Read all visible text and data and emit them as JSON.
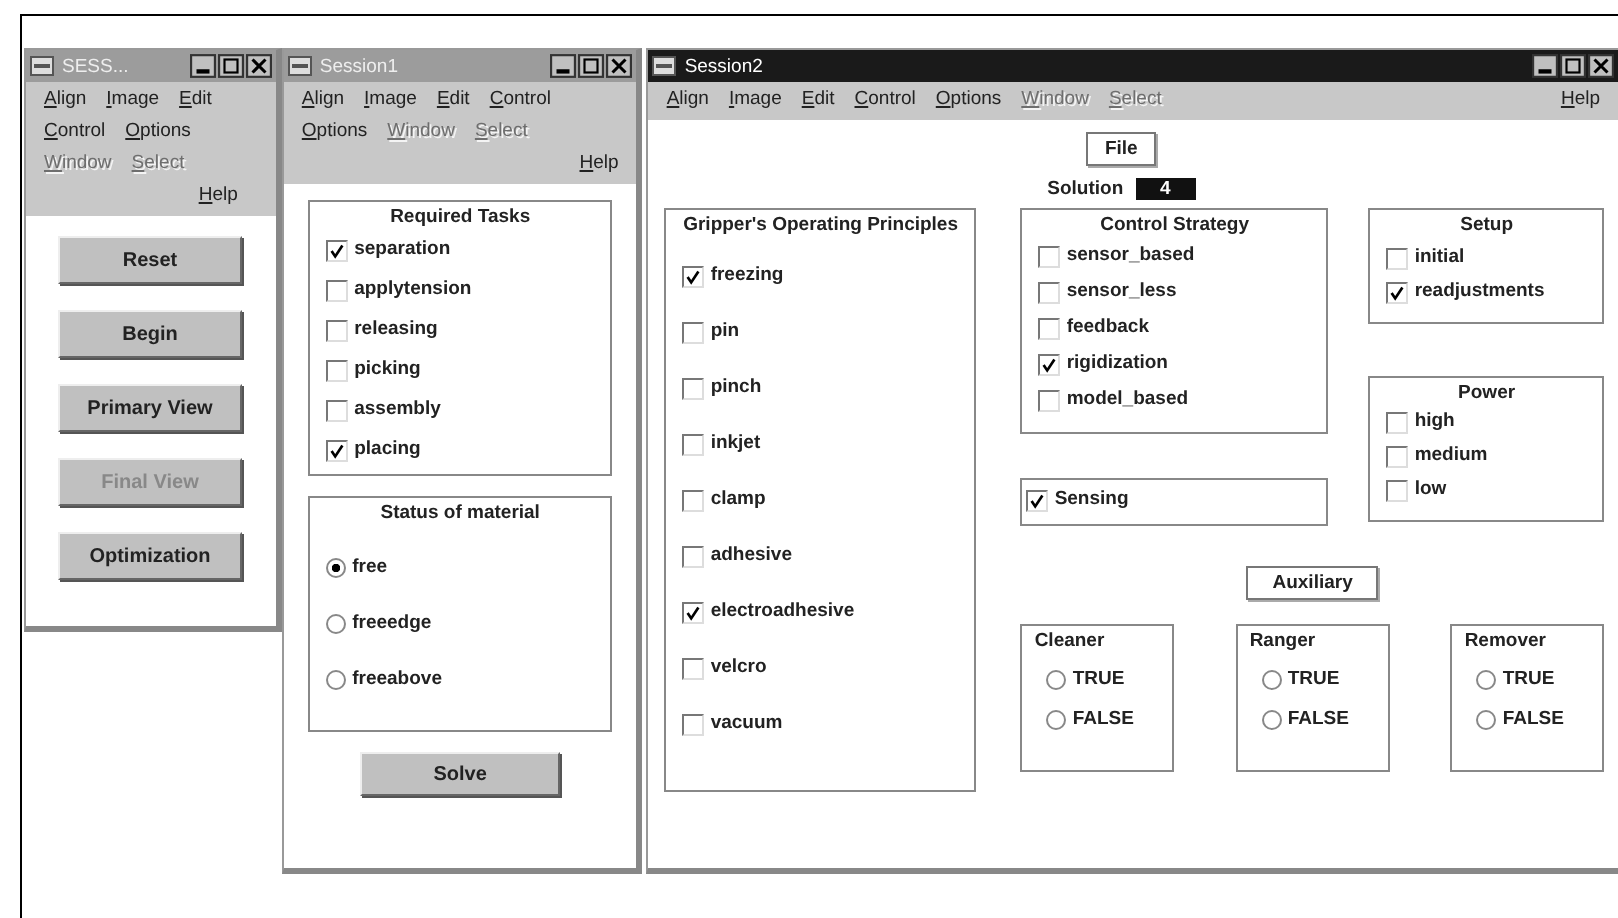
{
  "launcher_window": {
    "title": "SESS...",
    "active": false,
    "menu": [
      {
        "label": "Align",
        "disabled": false
      },
      {
        "label": "Image",
        "disabled": false
      },
      {
        "label": "Edit",
        "disabled": false
      },
      {
        "label": "Control",
        "disabled": false
      },
      {
        "label": "Options",
        "disabled": false
      },
      {
        "label": "Window",
        "disabled": true
      },
      {
        "label": "Select",
        "disabled": true
      },
      {
        "label": "Help",
        "disabled": false,
        "kind": "help"
      }
    ],
    "buttons": [
      {
        "label": "Reset",
        "disabled": false
      },
      {
        "label": "Begin",
        "disabled": false
      },
      {
        "label": "Primary View",
        "disabled": false
      },
      {
        "label": "Final View",
        "disabled": true
      },
      {
        "label": "Optimization",
        "disabled": false
      }
    ]
  },
  "session1_window": {
    "title": "Session1",
    "active": false,
    "menu": [
      {
        "label": "Align",
        "disabled": false
      },
      {
        "label": "Image",
        "disabled": false
      },
      {
        "label": "Edit",
        "disabled": false
      },
      {
        "label": "Control",
        "disabled": false
      },
      {
        "label": "Options",
        "disabled": false
      },
      {
        "label": "Window",
        "disabled": true
      },
      {
        "label": "Select",
        "disabled": true
      },
      {
        "label": "Help",
        "disabled": false,
        "kind": "help"
      }
    ],
    "required_tasks": {
      "title": "Required Tasks",
      "items": [
        {
          "label": "separation",
          "checked": true
        },
        {
          "label": "applytension",
          "checked": false
        },
        {
          "label": "releasing",
          "checked": false
        },
        {
          "label": "picking",
          "checked": false
        },
        {
          "label": "assembly",
          "checked": false
        },
        {
          "label": "placing",
          "checked": true
        }
      ]
    },
    "status_of_material": {
      "title": "Status of material",
      "options": [
        {
          "label": "free",
          "selected": true
        },
        {
          "label": "freeedge",
          "selected": false
        },
        {
          "label": "freeabove",
          "selected": false
        }
      ]
    },
    "solve_button": "Solve"
  },
  "session2_window": {
    "title": "Session2",
    "active": true,
    "menu": [
      {
        "label": "Align",
        "disabled": false
      },
      {
        "label": "Image",
        "disabled": false
      },
      {
        "label": "Edit",
        "disabled": false
      },
      {
        "label": "Control",
        "disabled": false
      },
      {
        "label": "Options",
        "disabled": false
      },
      {
        "label": "Window",
        "disabled": true
      },
      {
        "label": "Select",
        "disabled": true
      },
      {
        "label": "Help",
        "disabled": false,
        "kind": "help"
      }
    ],
    "file_button": "File",
    "solution": {
      "label": "Solution",
      "value": "4"
    },
    "operating_principles": {
      "title": "Gripper's Operating Principles",
      "items": [
        {
          "label": "freezing",
          "checked": true
        },
        {
          "label": "pin",
          "checked": false
        },
        {
          "label": "pinch",
          "checked": false
        },
        {
          "label": "inkjet",
          "checked": false
        },
        {
          "label": "clamp",
          "checked": false
        },
        {
          "label": "adhesive",
          "checked": false
        },
        {
          "label": "electroadhesive",
          "checked": true
        },
        {
          "label": "velcro",
          "checked": false
        },
        {
          "label": "vacuum",
          "checked": false
        }
      ]
    },
    "control_strategy": {
      "title": "Control Strategy",
      "items": [
        {
          "label": "sensor_based",
          "checked": false
        },
        {
          "label": "sensor_less",
          "checked": false
        },
        {
          "label": "feedback",
          "checked": false
        },
        {
          "label": "rigidization",
          "checked": true
        },
        {
          "label": "model_based",
          "checked": false
        }
      ]
    },
    "setup": {
      "title": "Setup",
      "items": [
        {
          "label": "initial",
          "checked": false
        },
        {
          "label": "readjustments",
          "checked": true
        }
      ]
    },
    "power": {
      "title": "Power",
      "items": [
        {
          "label": "high",
          "checked": false
        },
        {
          "label": "medium",
          "checked": false
        },
        {
          "label": "low",
          "checked": false
        }
      ]
    },
    "sensing": {
      "label": "Sensing",
      "checked": true
    },
    "auxiliary_button": "Auxiliary",
    "auxiliary_groups": [
      {
        "title": "Cleaner",
        "options": [
          {
            "label": "TRUE",
            "selected": false
          },
          {
            "label": "FALSE",
            "selected": false
          }
        ]
      },
      {
        "title": "Ranger",
        "options": [
          {
            "label": "TRUE",
            "selected": false
          },
          {
            "label": "FALSE",
            "selected": false
          }
        ]
      },
      {
        "title": "Remover",
        "options": [
          {
            "label": "TRUE",
            "selected": false
          },
          {
            "label": "FALSE",
            "selected": false
          }
        ]
      }
    ]
  }
}
